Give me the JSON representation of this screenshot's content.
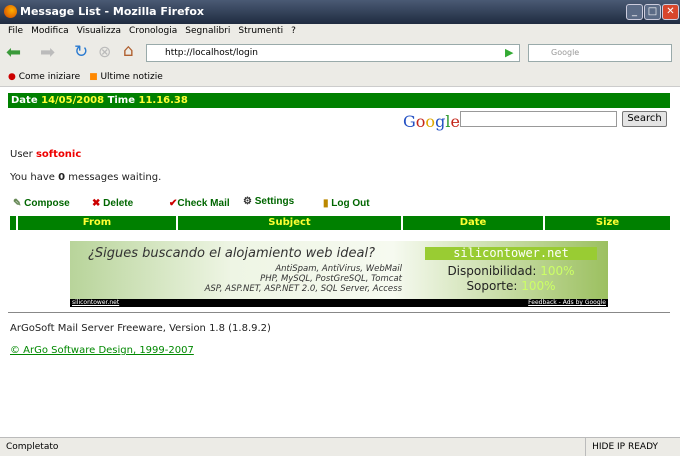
{
  "window": {
    "title": "Message List - Mozilla Firefox"
  },
  "menu": [
    "File",
    "Modifica",
    "Visualizza",
    "Cronologia",
    "Segnalibri",
    "Strumenti",
    "?"
  ],
  "url": "http://localhost/login",
  "search_placeholder": "Google",
  "bookmarks": [
    "Come iniziare",
    "Ultime notizie"
  ],
  "page": {
    "date_label": "Date",
    "date": "14/05/2008",
    "time_label": "Time",
    "time": "11.16.38",
    "google_logo": "Google",
    "search_button": "Search",
    "user_label": "User",
    "user": "softonic",
    "msg_prefix": "You have",
    "msg_count": "0",
    "msg_suffix": "messages waiting.",
    "actions": [
      "Compose",
      "Delete",
      "Check Mail",
      "Settings",
      "Log Out"
    ],
    "columns": [
      "From",
      "Subject",
      "Date",
      "Size"
    ],
    "ad": {
      "headline": "¿Sigues buscando el alojamiento web ideal?",
      "line1": "AntiSpam, AntiVirus, WebMail",
      "line2": "PHP, MySQL, PostGreSQL, Tomcat",
      "line3": "ASP, ASP.NET, ASP.NET 2.0, SQL Server, Access",
      "brand": "silicontower.net",
      "avail": "Disponibilidad:",
      "avail_val": "100%",
      "support": "Soporte:",
      "support_val": "100%",
      "foot_left": "silicontower.net",
      "foot_right": "Feedback - Ads by Google"
    },
    "version": "ArGoSoft Mail Server Freeware, Version 1.8 (1.8.9.2)",
    "copyright": "© ArGo Software Design, 1999-2007"
  },
  "status": {
    "left": "Completato",
    "right": "HIDE IP READY"
  }
}
